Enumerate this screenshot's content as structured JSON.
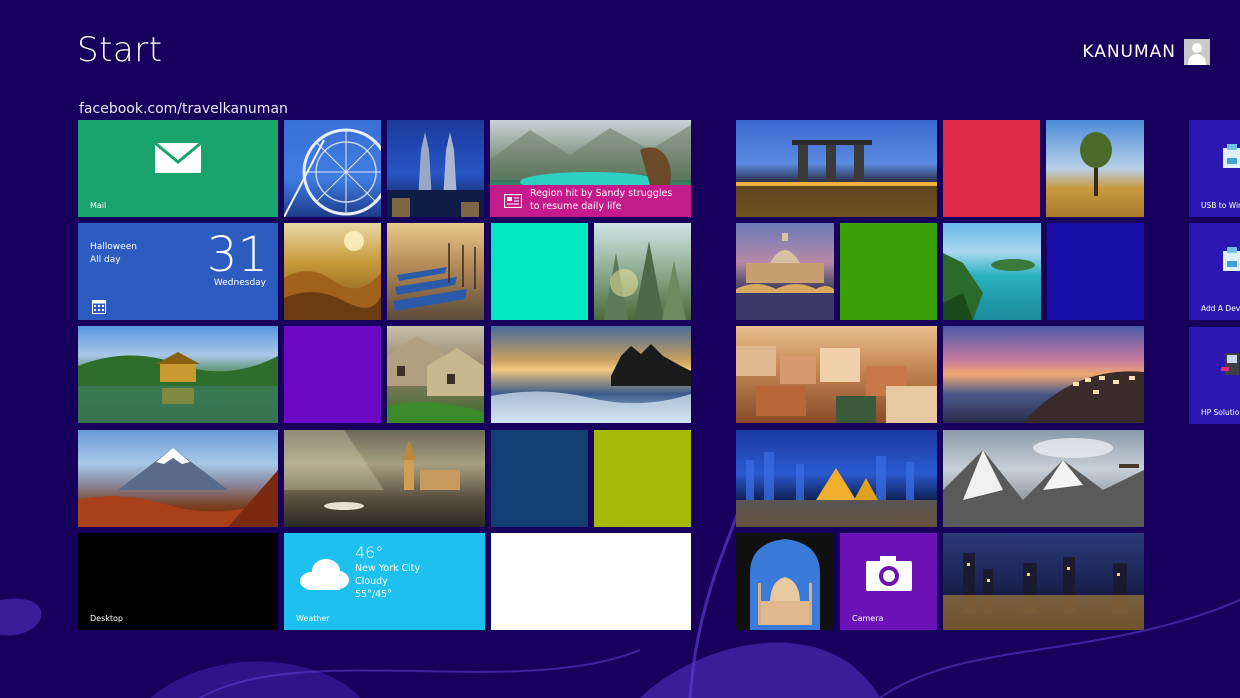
{
  "screen": {
    "title": "Start"
  },
  "user": {
    "name": "KANUMAN",
    "avatar_icon": "user-icon"
  },
  "group": {
    "label": "facebook.com/travelkanuman"
  },
  "colors": {
    "background": "#16005c",
    "mail": "#18a46a",
    "calendar": "#2c5cc0",
    "news": "#c41a8c",
    "weather": "#1ec0ee",
    "camera": "#6a12b8"
  },
  "tiles": {
    "mail": {
      "label": "Mail",
      "icon": "mail-icon"
    },
    "calendar": {
      "event_title": "Halloween",
      "event_time": "All day",
      "day_number": "31",
      "weekday": "Wednesday",
      "icon": "calendar-icon"
    },
    "news": {
      "headline_line1": "Region hit by Sandy struggles",
      "headline_line2": "to resume daily life",
      "icon": "newspaper-icon"
    },
    "desktop": {
      "label": "Desktop"
    },
    "weather": {
      "temperature": "46°",
      "city": "New York City",
      "condition": "Cloudy",
      "range": "55°/45°",
      "label": "Weather",
      "icon": "cloud-icon"
    },
    "camera": {
      "label": "Camera",
      "icon": "camera-icon"
    }
  },
  "side_tiles": [
    {
      "label": "USB to Win",
      "icon": "usb-app-icon"
    },
    {
      "label": "Add A Devi",
      "icon": "add-device-icon"
    },
    {
      "label": "HP Solution",
      "icon": "hp-solution-icon"
    }
  ]
}
